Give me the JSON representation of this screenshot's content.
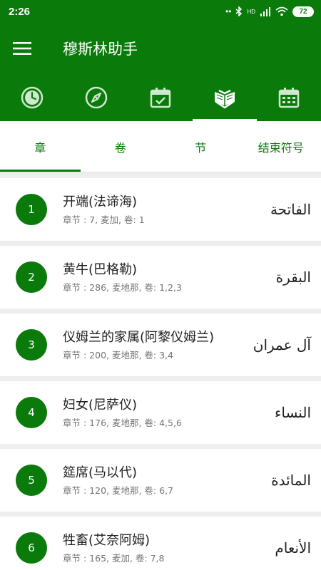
{
  "status_bar": {
    "time": "2:26",
    "net_label": "HD",
    "battery": "72"
  },
  "app": {
    "title": "穆斯林助手"
  },
  "icon_tabs": [
    {
      "icon": "clock-icon"
    },
    {
      "icon": "compass-icon"
    },
    {
      "icon": "calendar-check-icon"
    },
    {
      "icon": "quran-icon"
    },
    {
      "icon": "calendar-icon"
    }
  ],
  "text_tabs": [
    "章",
    "卷",
    "节",
    "结束符号"
  ],
  "surahs": [
    {
      "number": "1",
      "title": "开端(法谛海)",
      "meta": "章节 : 7, 麦加, 卷: 1",
      "arabic": "الفاتحة"
    },
    {
      "number": "2",
      "title": "黄牛(巴格勒)",
      "meta": "章节 : 286, 麦地那, 卷: 1,2,3",
      "arabic": "البقرة"
    },
    {
      "number": "3",
      "title": "仪姆兰的家属(阿黎仪姆兰)",
      "meta": "章节 : 200, 麦地那, 卷: 3,4",
      "arabic": "آل عمران"
    },
    {
      "number": "4",
      "title": "妇女(尼萨仪)",
      "meta": "章节 : 176, 麦地那, 卷: 4,5,6",
      "arabic": "النساء"
    },
    {
      "number": "5",
      "title": "筵席(马以代)",
      "meta": "章节 : 120, 麦地那, 卷: 6,7",
      "arabic": "المائدة"
    },
    {
      "number": "6",
      "title": "牲畜(艾奈阿姆)",
      "meta": "章节 : 165, 麦加, 卷: 7,8",
      "arabic": "الأنعام"
    }
  ],
  "colors": {
    "primary": "#0a7a0a",
    "background": "#eeeeee"
  }
}
